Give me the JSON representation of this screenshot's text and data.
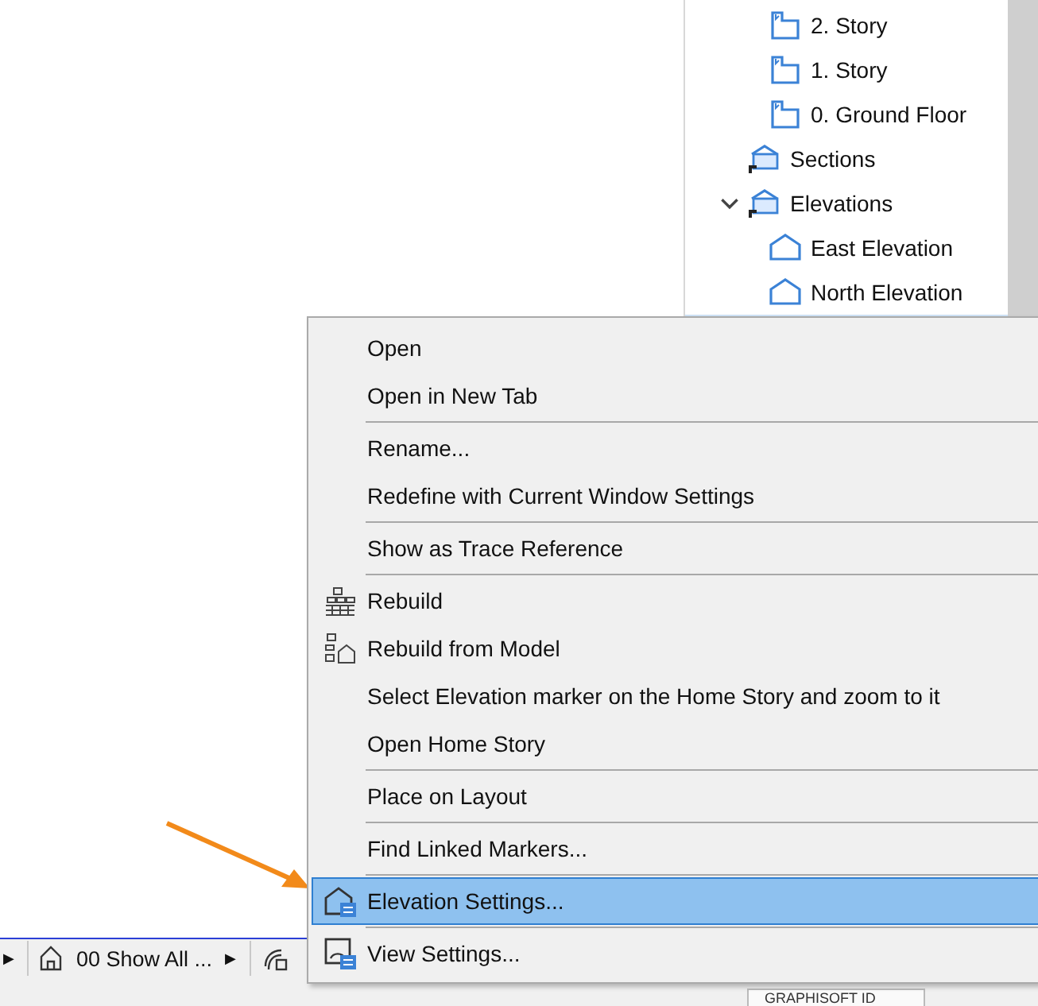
{
  "navigator": {
    "story_items": [
      {
        "label": "2. Story"
      },
      {
        "label": "1. Story"
      },
      {
        "label": "0. Ground Floor"
      }
    ],
    "view_items": [
      {
        "label": "Sections",
        "kind": "folder"
      },
      {
        "label": "Elevations",
        "kind": "folder",
        "expanded": true,
        "children": [
          {
            "label": "East Elevation",
            "kind": "elevation"
          },
          {
            "label": "North Elevation",
            "kind": "elevation"
          }
        ]
      }
    ]
  },
  "context_menu": [
    {
      "kind": "plain",
      "label": "Open",
      "selected": false
    },
    {
      "kind": "plain",
      "label": "Open in New Tab",
      "selected": false
    },
    {
      "kind": "separator"
    },
    {
      "kind": "plain",
      "label": "Rename...",
      "selected": false
    },
    {
      "kind": "plain",
      "label": "Redefine with Current Window Settings",
      "selected": false
    },
    {
      "kind": "separator"
    },
    {
      "kind": "plain",
      "label": "Show as Trace Reference",
      "selected": false
    },
    {
      "kind": "separator"
    },
    {
      "kind": "rebuild",
      "label": "Rebuild",
      "selected": false
    },
    {
      "kind": "rebuild_model",
      "label": "Rebuild from Model",
      "selected": false
    },
    {
      "kind": "plain",
      "label": "Select Elevation marker on the Home Story and zoom to it",
      "selected": false
    },
    {
      "kind": "plain",
      "label": "Open Home Story",
      "selected": false
    },
    {
      "kind": "separator"
    },
    {
      "kind": "plain",
      "label": "Place on Layout",
      "selected": false
    },
    {
      "kind": "separator"
    },
    {
      "kind": "plain",
      "label": "Find Linked Markers...",
      "selected": false
    },
    {
      "kind": "separator"
    },
    {
      "kind": "element_settings",
      "label": "Elevation Settings...",
      "selected": true
    },
    {
      "kind": "separator"
    },
    {
      "kind": "view_settings",
      "label": "View Settings...",
      "selected": false
    }
  ],
  "status_bar": {
    "arrow": "▶",
    "layer_combination": "00 Show All ...",
    "layer_arrow": "▶"
  },
  "footer": {
    "id_label": "GRAPHISOFT ID"
  }
}
